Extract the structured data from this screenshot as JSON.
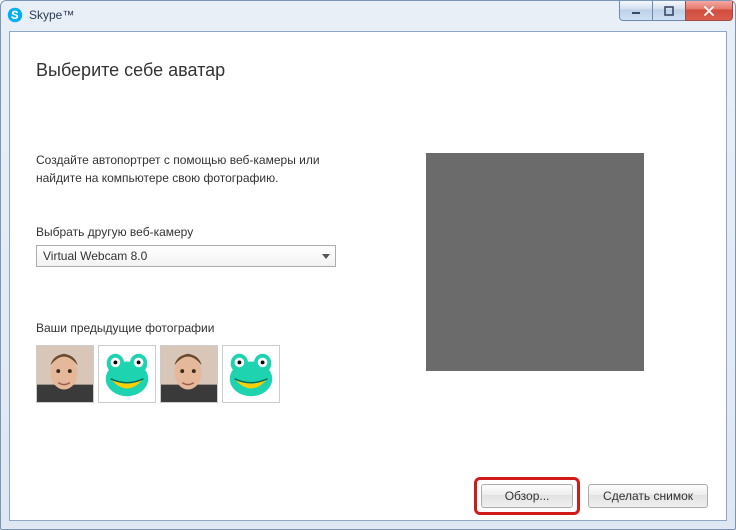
{
  "window": {
    "title": "Skype™"
  },
  "page": {
    "heading": "Выберите себе аватар",
    "instruction": "Создайте автопортрет с помощью веб-камеры или найдите на компьютере свою фотографию.",
    "webcam_label": "Выбрать другую веб-камеру",
    "webcam_selected": "Virtual Webcam 8.0",
    "prev_photos_label": "Ваши предыдущие фотографии"
  },
  "thumbnails": [
    {
      "kind": "photo"
    },
    {
      "kind": "cartoon"
    },
    {
      "kind": "photo"
    },
    {
      "kind": "cartoon"
    }
  ],
  "footer": {
    "browse_label": "Обзор...",
    "snapshot_label": "Сделать снимок"
  }
}
